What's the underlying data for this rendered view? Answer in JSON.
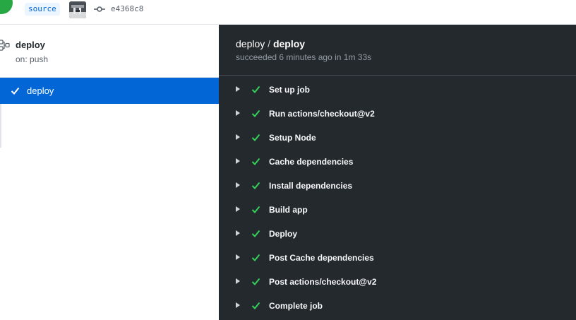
{
  "header": {
    "branch": "source",
    "commit_sha": "e4368c8",
    "icons": {
      "status": "success-circle-icon",
      "avatar": "user-avatar",
      "commit": "git-commit-icon"
    }
  },
  "sidebar": {
    "workflow_name": "deploy",
    "trigger": "on: push",
    "jobs": [
      {
        "label": "deploy",
        "status": "success",
        "selected": true
      }
    ]
  },
  "log": {
    "workflow": "deploy",
    "separator": "/",
    "job": "deploy",
    "summary": "succeeded 6 minutes ago in 1m 33s",
    "steps": [
      "Set up job",
      "Run actions/checkout@v2",
      "Setup Node",
      "Cache dependencies",
      "Install dependencies",
      "Build app",
      "Deploy",
      "Post Cache dependencies",
      "Post actions/checkout@v2",
      "Complete job"
    ]
  },
  "colors": {
    "success": "#28a745",
    "selected": "#0366d6",
    "log_bg": "#24292e",
    "step_check": "#34d058"
  }
}
